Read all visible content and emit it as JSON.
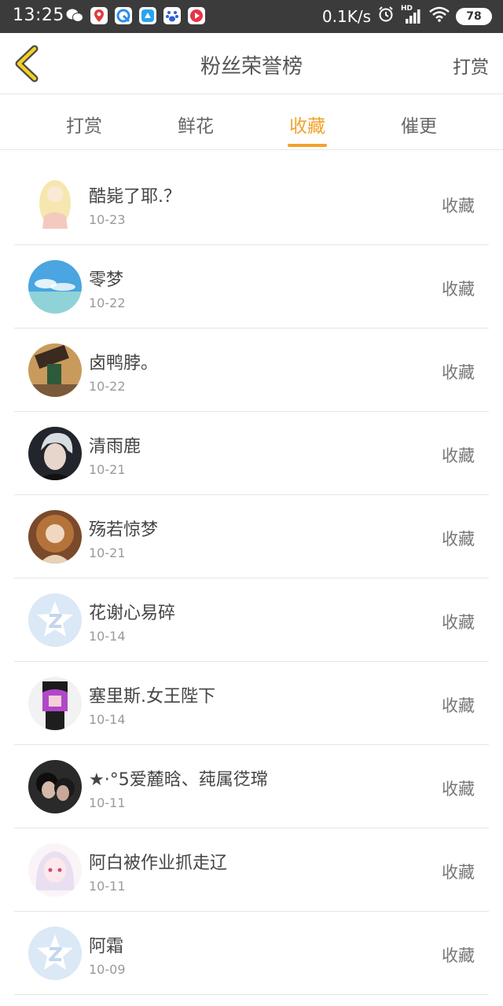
{
  "status_bar": {
    "time": "13:25",
    "network_speed": "0.1K/s",
    "battery": "78",
    "hd": "HD"
  },
  "header": {
    "title": "粉丝荣誉榜",
    "right_action": "打赏"
  },
  "tabs": [
    {
      "label": "打赏",
      "active": false
    },
    {
      "label": "鲜花",
      "active": false
    },
    {
      "label": "收藏",
      "active": true
    },
    {
      "label": "催更",
      "active": false
    }
  ],
  "accent_color": "#f2a12a",
  "list": [
    {
      "name": "酷毙了耶.？",
      "date": "10-23",
      "action": "收藏",
      "avatar": "anime-girl-blonde"
    },
    {
      "name": "零梦",
      "date": "10-22",
      "action": "收藏",
      "avatar": "sky-sea"
    },
    {
      "name": "卤鸭脖。",
      "date": "10-22",
      "action": "收藏",
      "avatar": "game-character"
    },
    {
      "name": "清雨鹿",
      "date": "10-21",
      "action": "收藏",
      "avatar": "boy-silver-hair"
    },
    {
      "name": "殇若惊梦",
      "date": "10-21",
      "action": "收藏",
      "avatar": "ornate-portrait"
    },
    {
      "name": "花谢心易碎",
      "date": "10-14",
      "action": "收藏",
      "avatar": "default-qzone-star"
    },
    {
      "name": "塞里斯.女王陛下",
      "date": "10-14",
      "action": "收藏",
      "avatar": "purple-hair-character"
    },
    {
      "name": "★·°5爱麓晗、莼属徔瑺",
      "date": "10-11",
      "action": "收藏",
      "avatar": "couple-photo"
    },
    {
      "name": "阿白被作业抓走辽",
      "date": "10-11",
      "action": "收藏",
      "avatar": "anime-girl-white-hair"
    },
    {
      "name": "阿霜",
      "date": "10-09",
      "action": "收藏",
      "avatar": "default-qzone-star"
    }
  ]
}
